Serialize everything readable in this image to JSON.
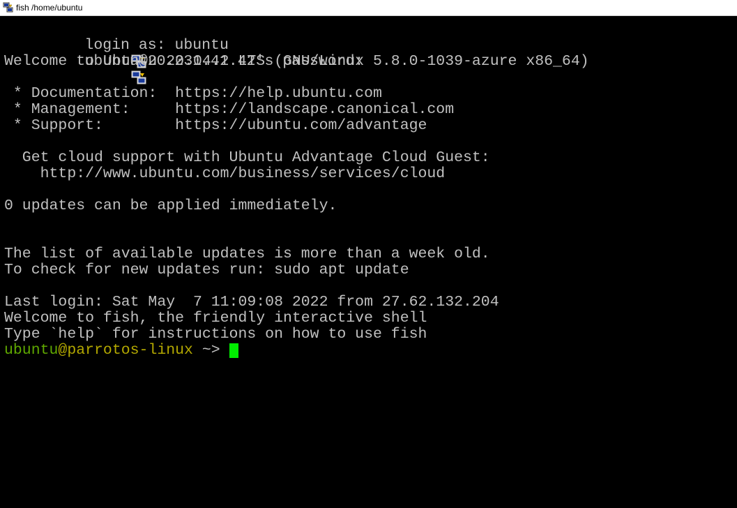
{
  "window": {
    "title": "fish /home/ubuntu"
  },
  "icons": {
    "app": "putty-icon",
    "login_prefix": "putty-icon"
  },
  "colors": {
    "background": "#000000",
    "text": "#c0c0c0",
    "prompt_user": "#5fa800",
    "prompt_host": "#b3a800",
    "cursor": "#00ee00"
  },
  "terminal": {
    "lines": [
      "login as: ubuntu",
      "ubuntu@20.231.41.42's password:",
      "Welcome to Ubuntu 20.04.2 LTS (GNU/Linux 5.8.0-1039-azure x86_64)",
      "",
      " * Documentation:  https://help.ubuntu.com",
      " * Management:     https://landscape.canonical.com",
      " * Support:        https://ubuntu.com/advantage",
      "",
      "  Get cloud support with Ubuntu Advantage Cloud Guest:",
      "    http://www.ubuntu.com/business/services/cloud",
      "",
      "0 updates can be applied immediately.",
      "",
      "",
      "The list of available updates is more than a week old.",
      "To check for new updates run: sudo apt update",
      "",
      "Last login: Sat May  7 11:09:08 2022 from 27.62.132.204",
      "Welcome to fish, the friendly interactive shell",
      "Type `help` for instructions on how to use fish"
    ],
    "prompt": {
      "user": "ubuntu",
      "host": "@parrotos-linux",
      "cwd": " ~> "
    }
  }
}
